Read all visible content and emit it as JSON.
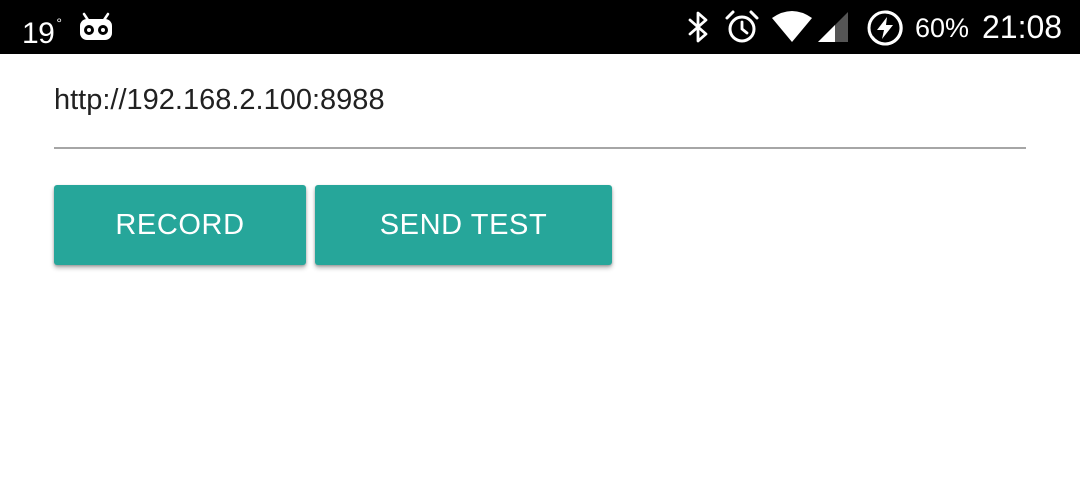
{
  "status_bar": {
    "temperature": "19",
    "temperature_unit": "°",
    "battery_percent": "60%",
    "time": "21:08",
    "icons": [
      "android-icon",
      "bluetooth-icon",
      "alarm-icon",
      "wifi-icon",
      "cellular-signal-icon",
      "battery-charging-icon"
    ]
  },
  "url_field": {
    "value": "http://192.168.2.100:8988"
  },
  "buttons": {
    "record_label": "RECORD",
    "send_test_label": "SEND TEST"
  },
  "colors": {
    "accent": "#26a69a",
    "status_bar_bg": "#000000",
    "underline": "#a6a6a6",
    "text": "#212121"
  }
}
